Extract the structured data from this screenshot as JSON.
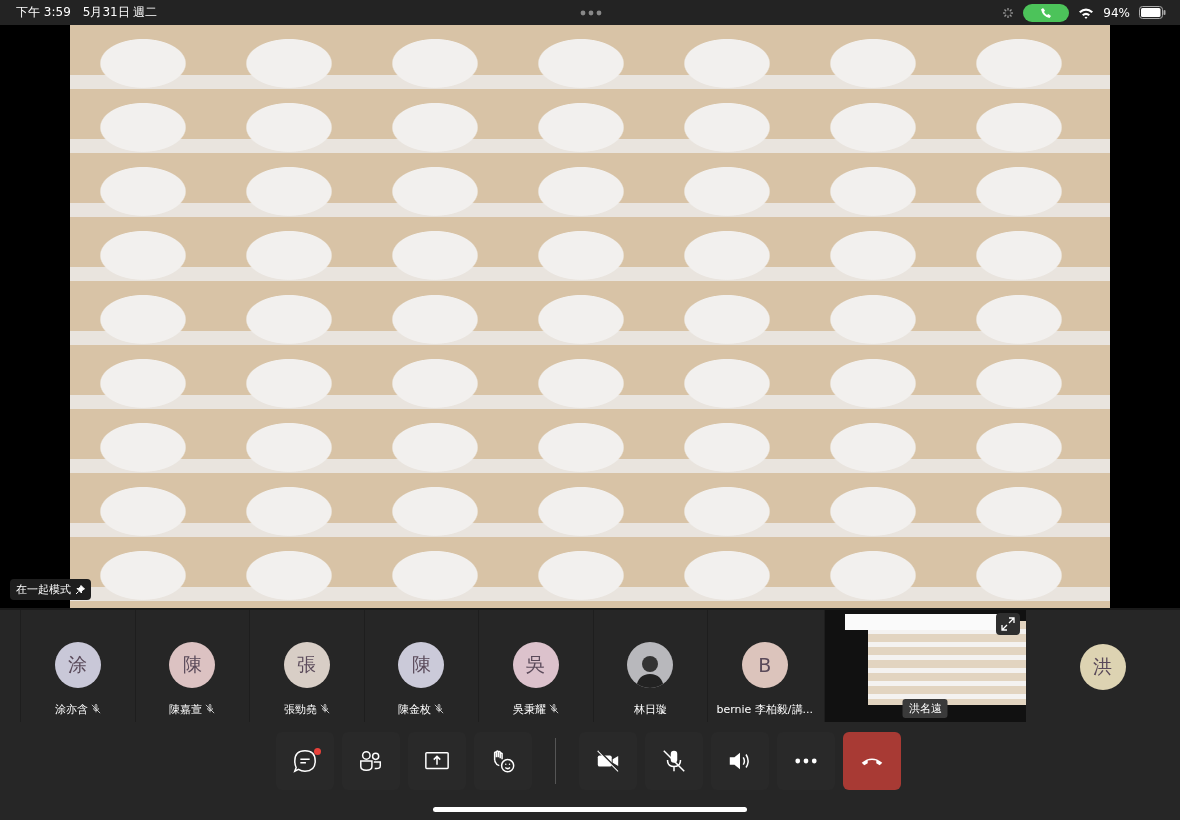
{
  "status_bar": {
    "time": "下午 3:59",
    "date": "5月31日 週二",
    "battery": "94%",
    "call_active": true
  },
  "stage": {
    "mode_label": "在一起模式"
  },
  "participants": [
    {
      "kind": "initial",
      "initial": "涂",
      "name": "涂亦含",
      "muted": true,
      "color": "#c9c8d8"
    },
    {
      "kind": "initial",
      "initial": "陳",
      "name": "陳嘉萱",
      "muted": true,
      "color": "#dcc2c2"
    },
    {
      "kind": "initial",
      "initial": "張",
      "name": "張勁堯",
      "muted": true,
      "color": "#d8cec6"
    },
    {
      "kind": "initial",
      "initial": "陳",
      "name": "陳金枚",
      "muted": true,
      "color": "#cbcad9"
    },
    {
      "kind": "initial",
      "initial": "吳",
      "name": "吳秉耀",
      "muted": true,
      "color": "#dcc2cc"
    },
    {
      "kind": "photo",
      "name": "林日璇",
      "muted": false
    },
    {
      "kind": "initial",
      "initial": "B",
      "name": "bernie 李柏毅/講...",
      "muted": false,
      "color": "#dcc4bc"
    },
    {
      "kind": "share",
      "name": "洪名遠"
    },
    {
      "kind": "initial",
      "initial": "洪",
      "color": "#ddd3b2"
    }
  ],
  "toolbar": [
    {
      "kind": "chat",
      "unread": true
    },
    {
      "kind": "people"
    },
    {
      "kind": "share"
    },
    {
      "kind": "react"
    },
    {
      "kind": "divider"
    },
    {
      "kind": "camera",
      "on": false
    },
    {
      "kind": "mic",
      "on": false
    },
    {
      "kind": "speaker"
    },
    {
      "kind": "more"
    },
    {
      "kind": "hangup"
    }
  ]
}
